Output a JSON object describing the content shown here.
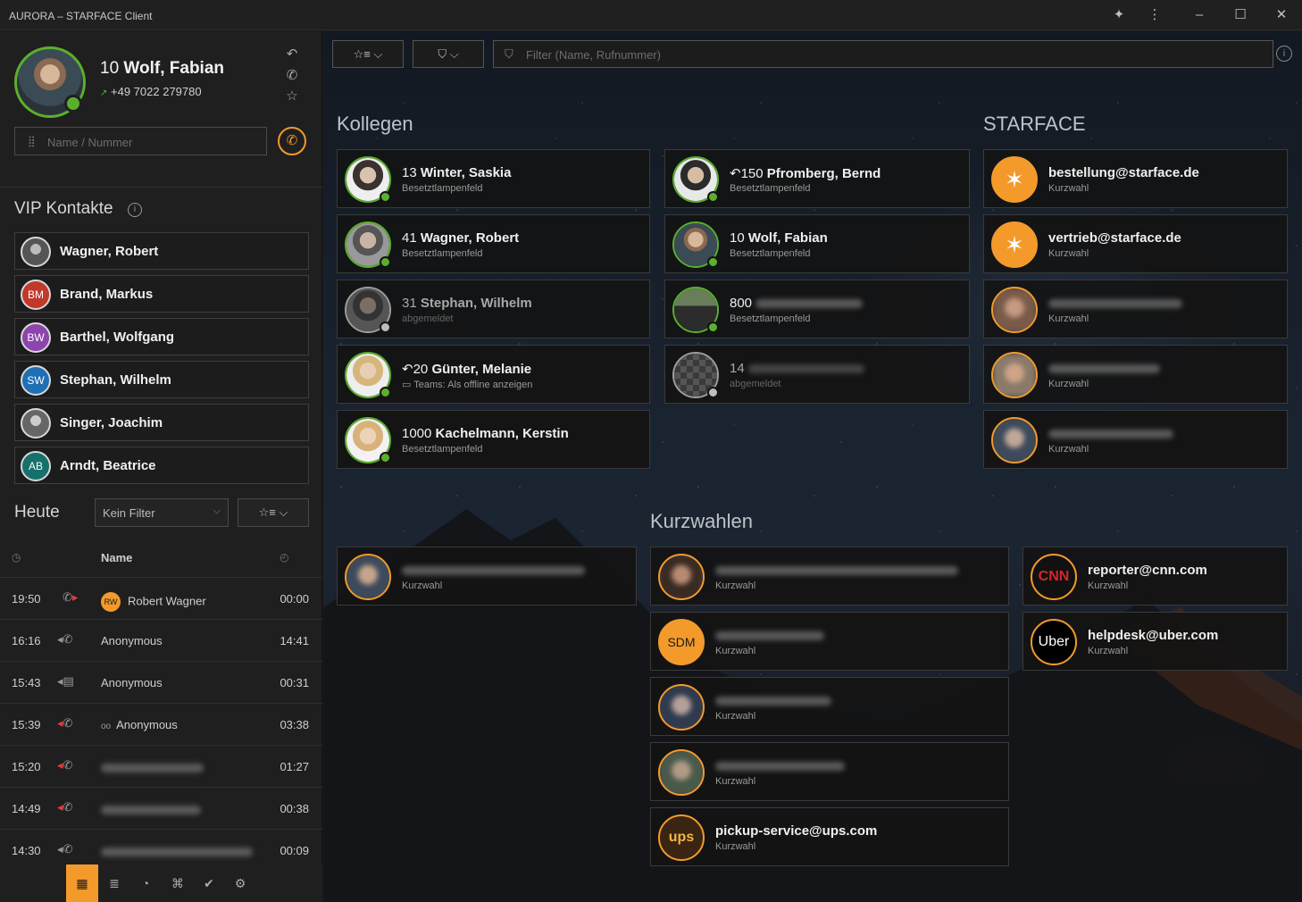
{
  "window": {
    "title": "AURORA – STARFACE Client",
    "buttons": [
      "puzzle-icon",
      "more-vertical-icon",
      "minimize-icon",
      "maximize-icon",
      "close-icon"
    ]
  },
  "me": {
    "ext": "10",
    "name": "Wolf, Fabian",
    "number": "+49 7022 279780",
    "status_color": "#5ab02c"
  },
  "search": {
    "placeholder": "Name / Nummer"
  },
  "vip": {
    "title": "VIP Kontakte",
    "items": [
      {
        "name": "Wagner, Robert",
        "initials": "",
        "color": "#555555"
      },
      {
        "name": "Brand, Markus",
        "initials": "BM",
        "color": "#c0392b"
      },
      {
        "name": "Barthel, Wolfgang",
        "initials": "BW",
        "color": "#8e44ad"
      },
      {
        "name": "Stephan, Wilhelm",
        "initials": "SW",
        "color": "#1f6fb5"
      },
      {
        "name": "Singer, Joachim",
        "initials": "",
        "color": "#666666"
      },
      {
        "name": "Arndt, Beatrice",
        "initials": "AB",
        "color": "#16706b"
      }
    ]
  },
  "history": {
    "title": "Heute",
    "filter": "Kein Filter",
    "col_name": "Name",
    "rows": [
      {
        "time": "19:50",
        "name": "Robert Wagner",
        "badge": "RW",
        "dur": "00:00"
      },
      {
        "time": "16:16",
        "name": "Anonymous",
        "dur": "14:41"
      },
      {
        "time": "15:43",
        "name": "Anonymous",
        "dur": "00:31"
      },
      {
        "time": "15:39",
        "name": "Anonymous",
        "dur": "03:38"
      },
      {
        "time": "15:20",
        "name": "",
        "dur": "01:27"
      },
      {
        "time": "14:49",
        "name": "",
        "dur": "00:38"
      },
      {
        "time": "14:30",
        "name": "",
        "dur": "00:09"
      }
    ]
  },
  "main": {
    "filter_placeholder": "Filter (Name, Rufnummer)",
    "sections": {
      "kollegen": "Kollegen",
      "starface": "STARFACE",
      "kurzwahlen": "Kurzwahlen"
    },
    "kollegen_col1": [
      {
        "ext": "13",
        "name": "Winter, Saskia",
        "sub": "Besetztlampenfeld",
        "status": "online"
      },
      {
        "ext": "41",
        "name": "Wagner, Robert",
        "sub": "Besetztlampenfeld",
        "status": "online"
      },
      {
        "ext": "31",
        "name": "Stephan, Wilhelm",
        "sub": "abgemeldet",
        "status": "offline"
      },
      {
        "ext": "20",
        "name": "Günter, Melanie",
        "sub": "Teams: Als offline anzeigen",
        "status": "online"
      },
      {
        "ext": "1000",
        "name": "Kachelmann, Kerstin",
        "sub": "Besetztlampenfeld",
        "status": "online"
      }
    ],
    "kollegen_col2": [
      {
        "ext": "150",
        "name": "Pfromberg, Bernd",
        "sub": "Besetztlampenfeld",
        "status": "online"
      },
      {
        "ext": "10",
        "name": "Wolf, Fabian",
        "sub": "Besetztlampenfeld",
        "status": "online"
      },
      {
        "ext": "800",
        "name": "",
        "sub": "Besetztlampenfeld",
        "status": "online"
      },
      {
        "ext": "14",
        "name": "",
        "sub": "abgemeldet",
        "status": "offline"
      }
    ],
    "starface_col": [
      {
        "name": "bestellung@starface.de",
        "sub": "Kurzwahl"
      },
      {
        "name": "vertrieb@starface.de",
        "sub": "Kurzwahl"
      },
      {
        "name": "",
        "sub": "Kurzwahl"
      },
      {
        "name": "",
        "sub": "Kurzwahl"
      },
      {
        "name": "",
        "sub": "Kurzwahl"
      }
    ],
    "kurz_col1": [
      {
        "name": "",
        "sub": "Kurzwahl"
      }
    ],
    "kurz_col2": [
      {
        "name": "",
        "sub": "Kurzwahl"
      },
      {
        "name": "",
        "sub": "Kurzwahl",
        "initials": "SDM"
      },
      {
        "name": "",
        "sub": "Kurzwahl"
      },
      {
        "name": "",
        "sub": "Kurzwahl"
      },
      {
        "name": "pickup-service@ups.com",
        "sub": "Kurzwahl",
        "logo": "ups"
      }
    ],
    "kurz_col3": [
      {
        "name": "reporter@cnn.com",
        "sub": "Kurzwahl",
        "logo": "CNN"
      },
      {
        "name": "helpdesk@uber.com",
        "sub": "Kurzwahl",
        "logo": "Uber"
      }
    ]
  },
  "colors": {
    "accent": "#f39a2b",
    "online": "#5ab02c",
    "missed": "#e53b3b"
  }
}
